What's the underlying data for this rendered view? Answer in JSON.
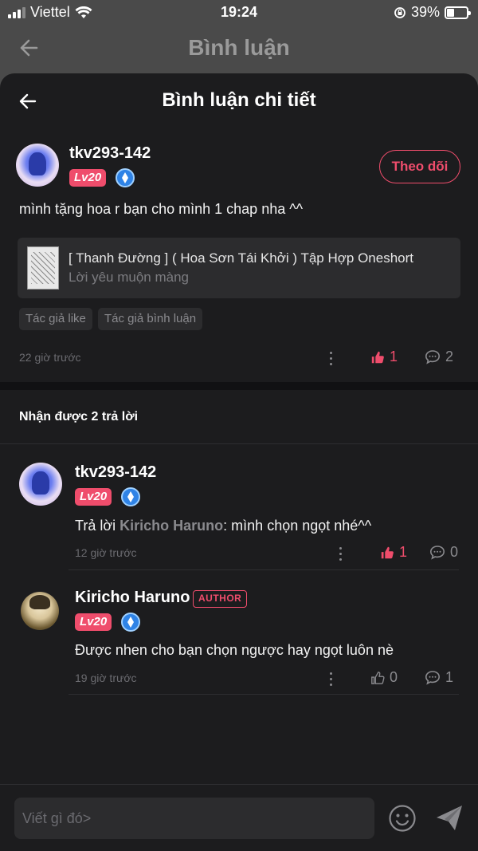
{
  "status_bar": {
    "carrier": "Viettel",
    "time": "19:24",
    "battery": "39%"
  },
  "background_header": {
    "title": "Bình luận"
  },
  "sheet_header": {
    "title": "Bình luận chi tiết"
  },
  "main_comment": {
    "username": "tkv293-142",
    "level": "Lv20",
    "follow_label": "Theo dõi",
    "text": "mình tặng hoa r bạn cho mình 1 chap nha ^^",
    "book": {
      "title": "[ Thanh Đường ] ( Hoa Sơn Tái Khởi ) Tập Hợp Oneshort",
      "subtitle": "Lời yêu muộn màng"
    },
    "tags": [
      "Tác giả like",
      "Tác giả bình luận"
    ],
    "time": "22 giờ trước",
    "likes": "1",
    "replies": "2",
    "liked": true
  },
  "replies_header": "Nhận được 2 trả lời",
  "replies": [
    {
      "username": "tkv293-142",
      "level": "Lv20",
      "reply_prefix": "Trả lời",
      "reply_to": "Kiricho Haruno",
      "text": ": mình chọn ngọt nhé^^",
      "time": "12 giờ trước",
      "likes": "1",
      "comments": "0",
      "liked": true
    },
    {
      "username": "Kiricho Haruno",
      "author_badge": "AUTHOR",
      "level": "Lv20",
      "text": "Được nhen cho bạn chọn ngược hay ngọt luôn nè",
      "time": "19 giờ trước",
      "likes": "0",
      "comments": "1",
      "liked": false
    }
  ],
  "composer": {
    "placeholder": "Viết gì đó>"
  },
  "colors": {
    "accent": "#ef4d6c",
    "background": "#1c1c1e",
    "surface": "#2c2c2e",
    "muted": "#8a8a8e"
  }
}
